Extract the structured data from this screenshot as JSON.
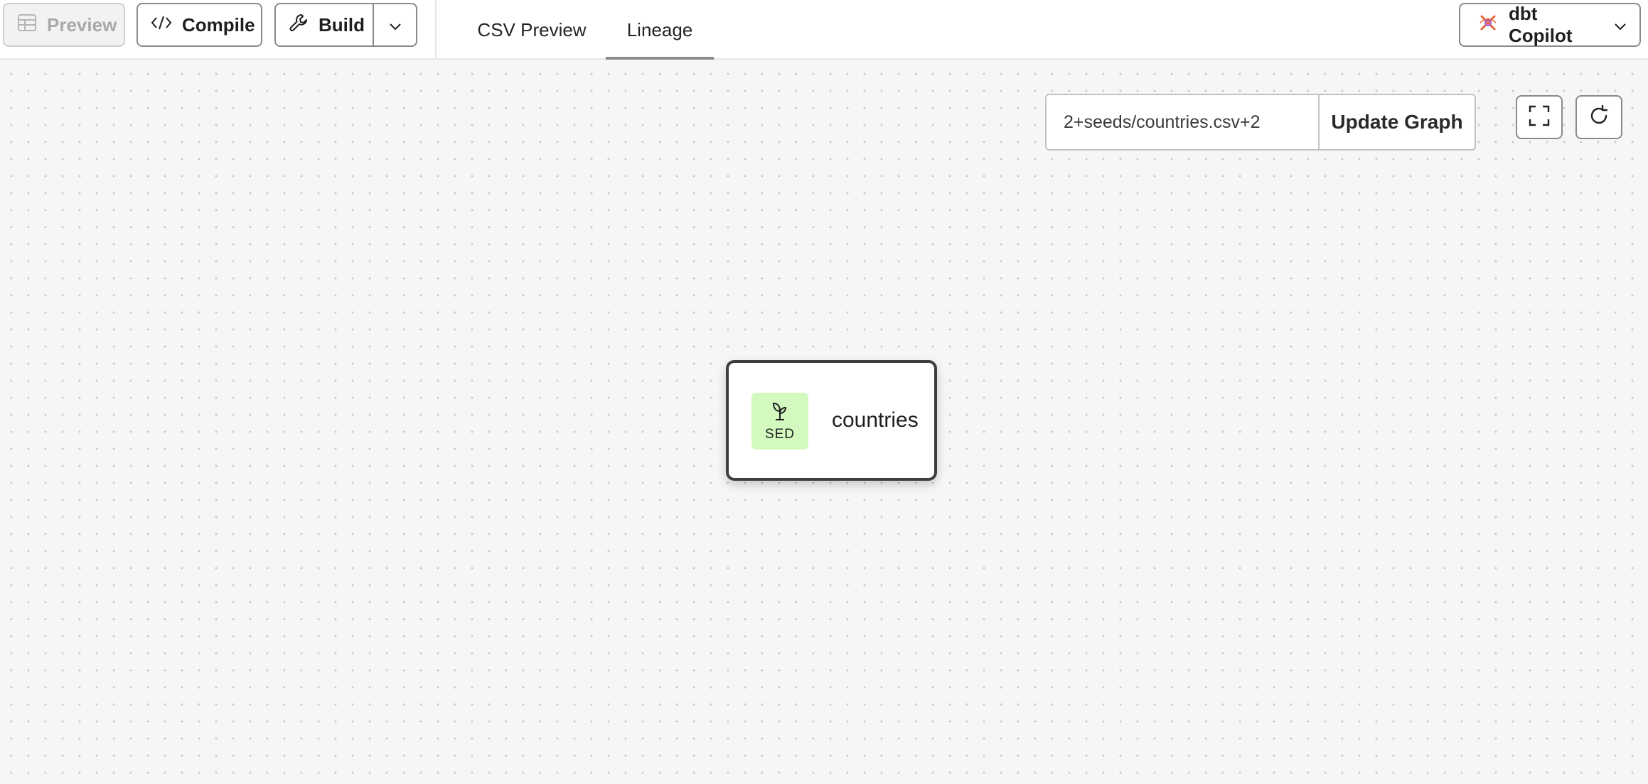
{
  "toolbar": {
    "preview_label": "Preview",
    "compile_label": "Compile",
    "build_label": "Build",
    "copilot_label": "dbt Copilot",
    "copilot_accent": "#e8643a"
  },
  "tabs": [
    {
      "label": "CSV Preview",
      "active": false
    },
    {
      "label": "Lineage",
      "active": true
    }
  ],
  "graph": {
    "selector_value": "2+seeds/countries.csv+2",
    "update_label": "Update Graph",
    "node": {
      "type_label": "SED",
      "name": "countries",
      "badge_color": "#d3f9bf",
      "icon": "seed-sprout-icon"
    }
  }
}
